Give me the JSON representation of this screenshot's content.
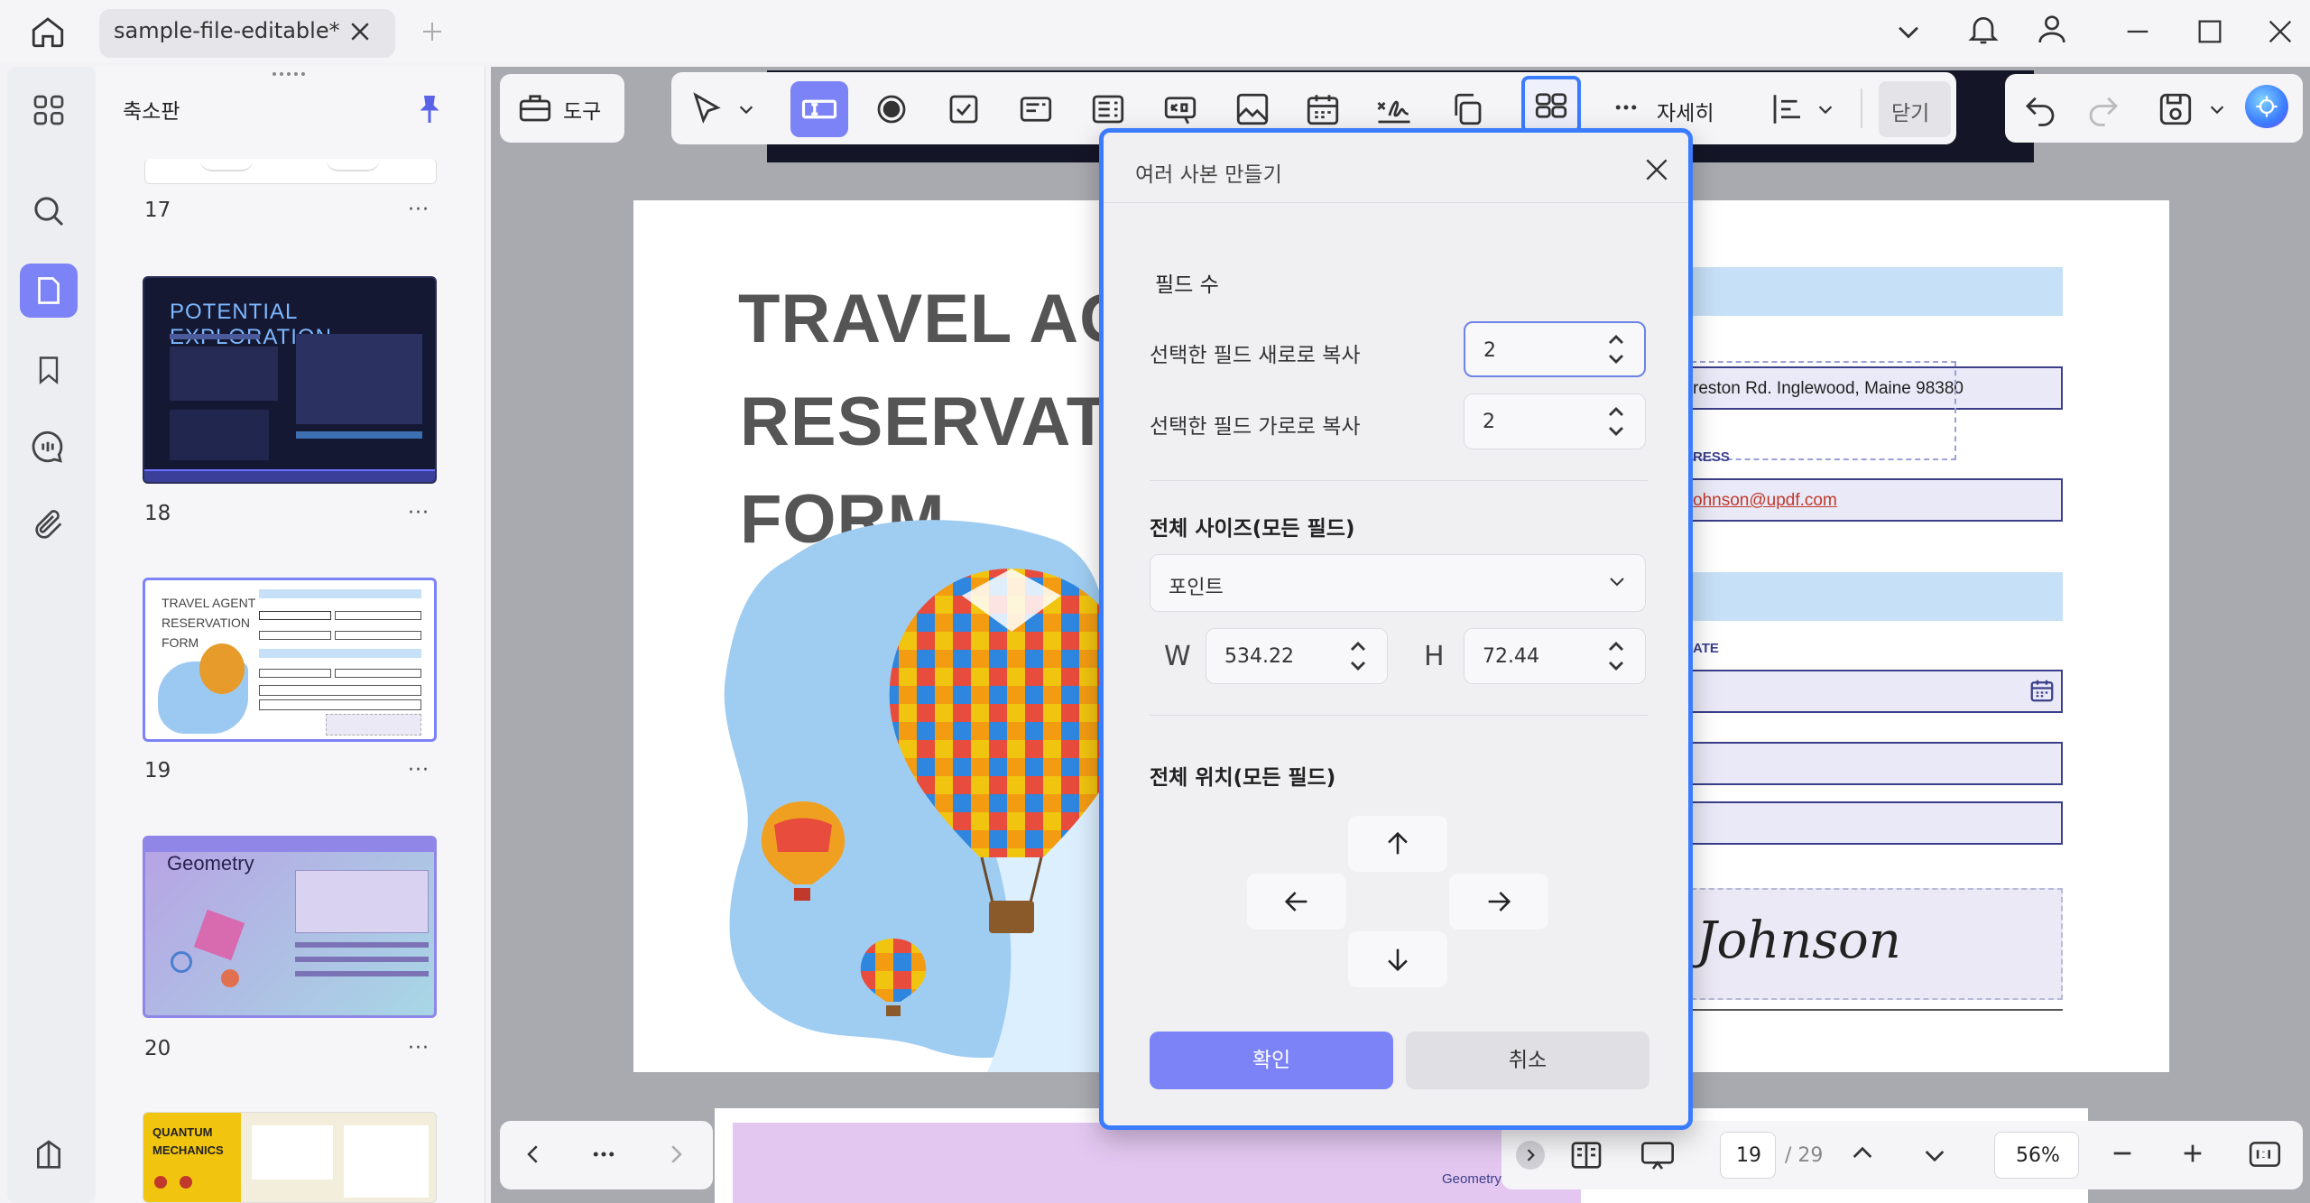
{
  "tab": {
    "title": "sample-file-editable*"
  },
  "panel": {
    "title": "축소판",
    "pages": [
      {
        "num": "17"
      },
      {
        "num": "18",
        "heading": "POTENTIAL EXPLORATION"
      },
      {
        "num": "19",
        "heading": "TRAVEL AGENT RESERVATION FORM"
      },
      {
        "num": "20",
        "heading": "Geometry"
      },
      {
        "heading": "QUANTUM MECHANICS"
      }
    ],
    "more": "···"
  },
  "toolbar": {
    "tools_label": "도구",
    "more_label": "자세히",
    "close_label": "닫기"
  },
  "document": {
    "title_lines": [
      "TRAVEL AGE",
      "RESERVATIO",
      "FORM"
    ],
    "address_value": "reston Rd. Inglewood, Maine 98380",
    "address_label_partial": "RESS",
    "email_value": "ohnson@updf.com",
    "date_label_partial": "ATE",
    "signature": "Johnson",
    "next_page_caption": "Geometry I"
  },
  "dialog": {
    "title": "여러 사본 만들기",
    "field_count_heading": "필드 수",
    "copy_vertical_label": "선택한 필드 새로로 복사",
    "copy_vertical_value": "2",
    "copy_horizontal_label": "선택한 필드 가로로 복사",
    "copy_horizontal_value": "2",
    "size_heading": "전체 사이즈(모든 필드)",
    "unit_selected": "포인트",
    "w_label": "W",
    "w_value": "534.22",
    "h_label": "H",
    "h_value": "72.44",
    "position_heading": "전체 위치(모든 필드)",
    "confirm_label": "확인",
    "cancel_label": "취소"
  },
  "statusbar": {
    "current_page": "19",
    "total_pages": "/ 29",
    "zoom": "56%",
    "more": "···"
  },
  "colors": {
    "accent": "#7b83f7",
    "dialog_border": "#3b7cff",
    "field_border": "#3b3f8a"
  }
}
